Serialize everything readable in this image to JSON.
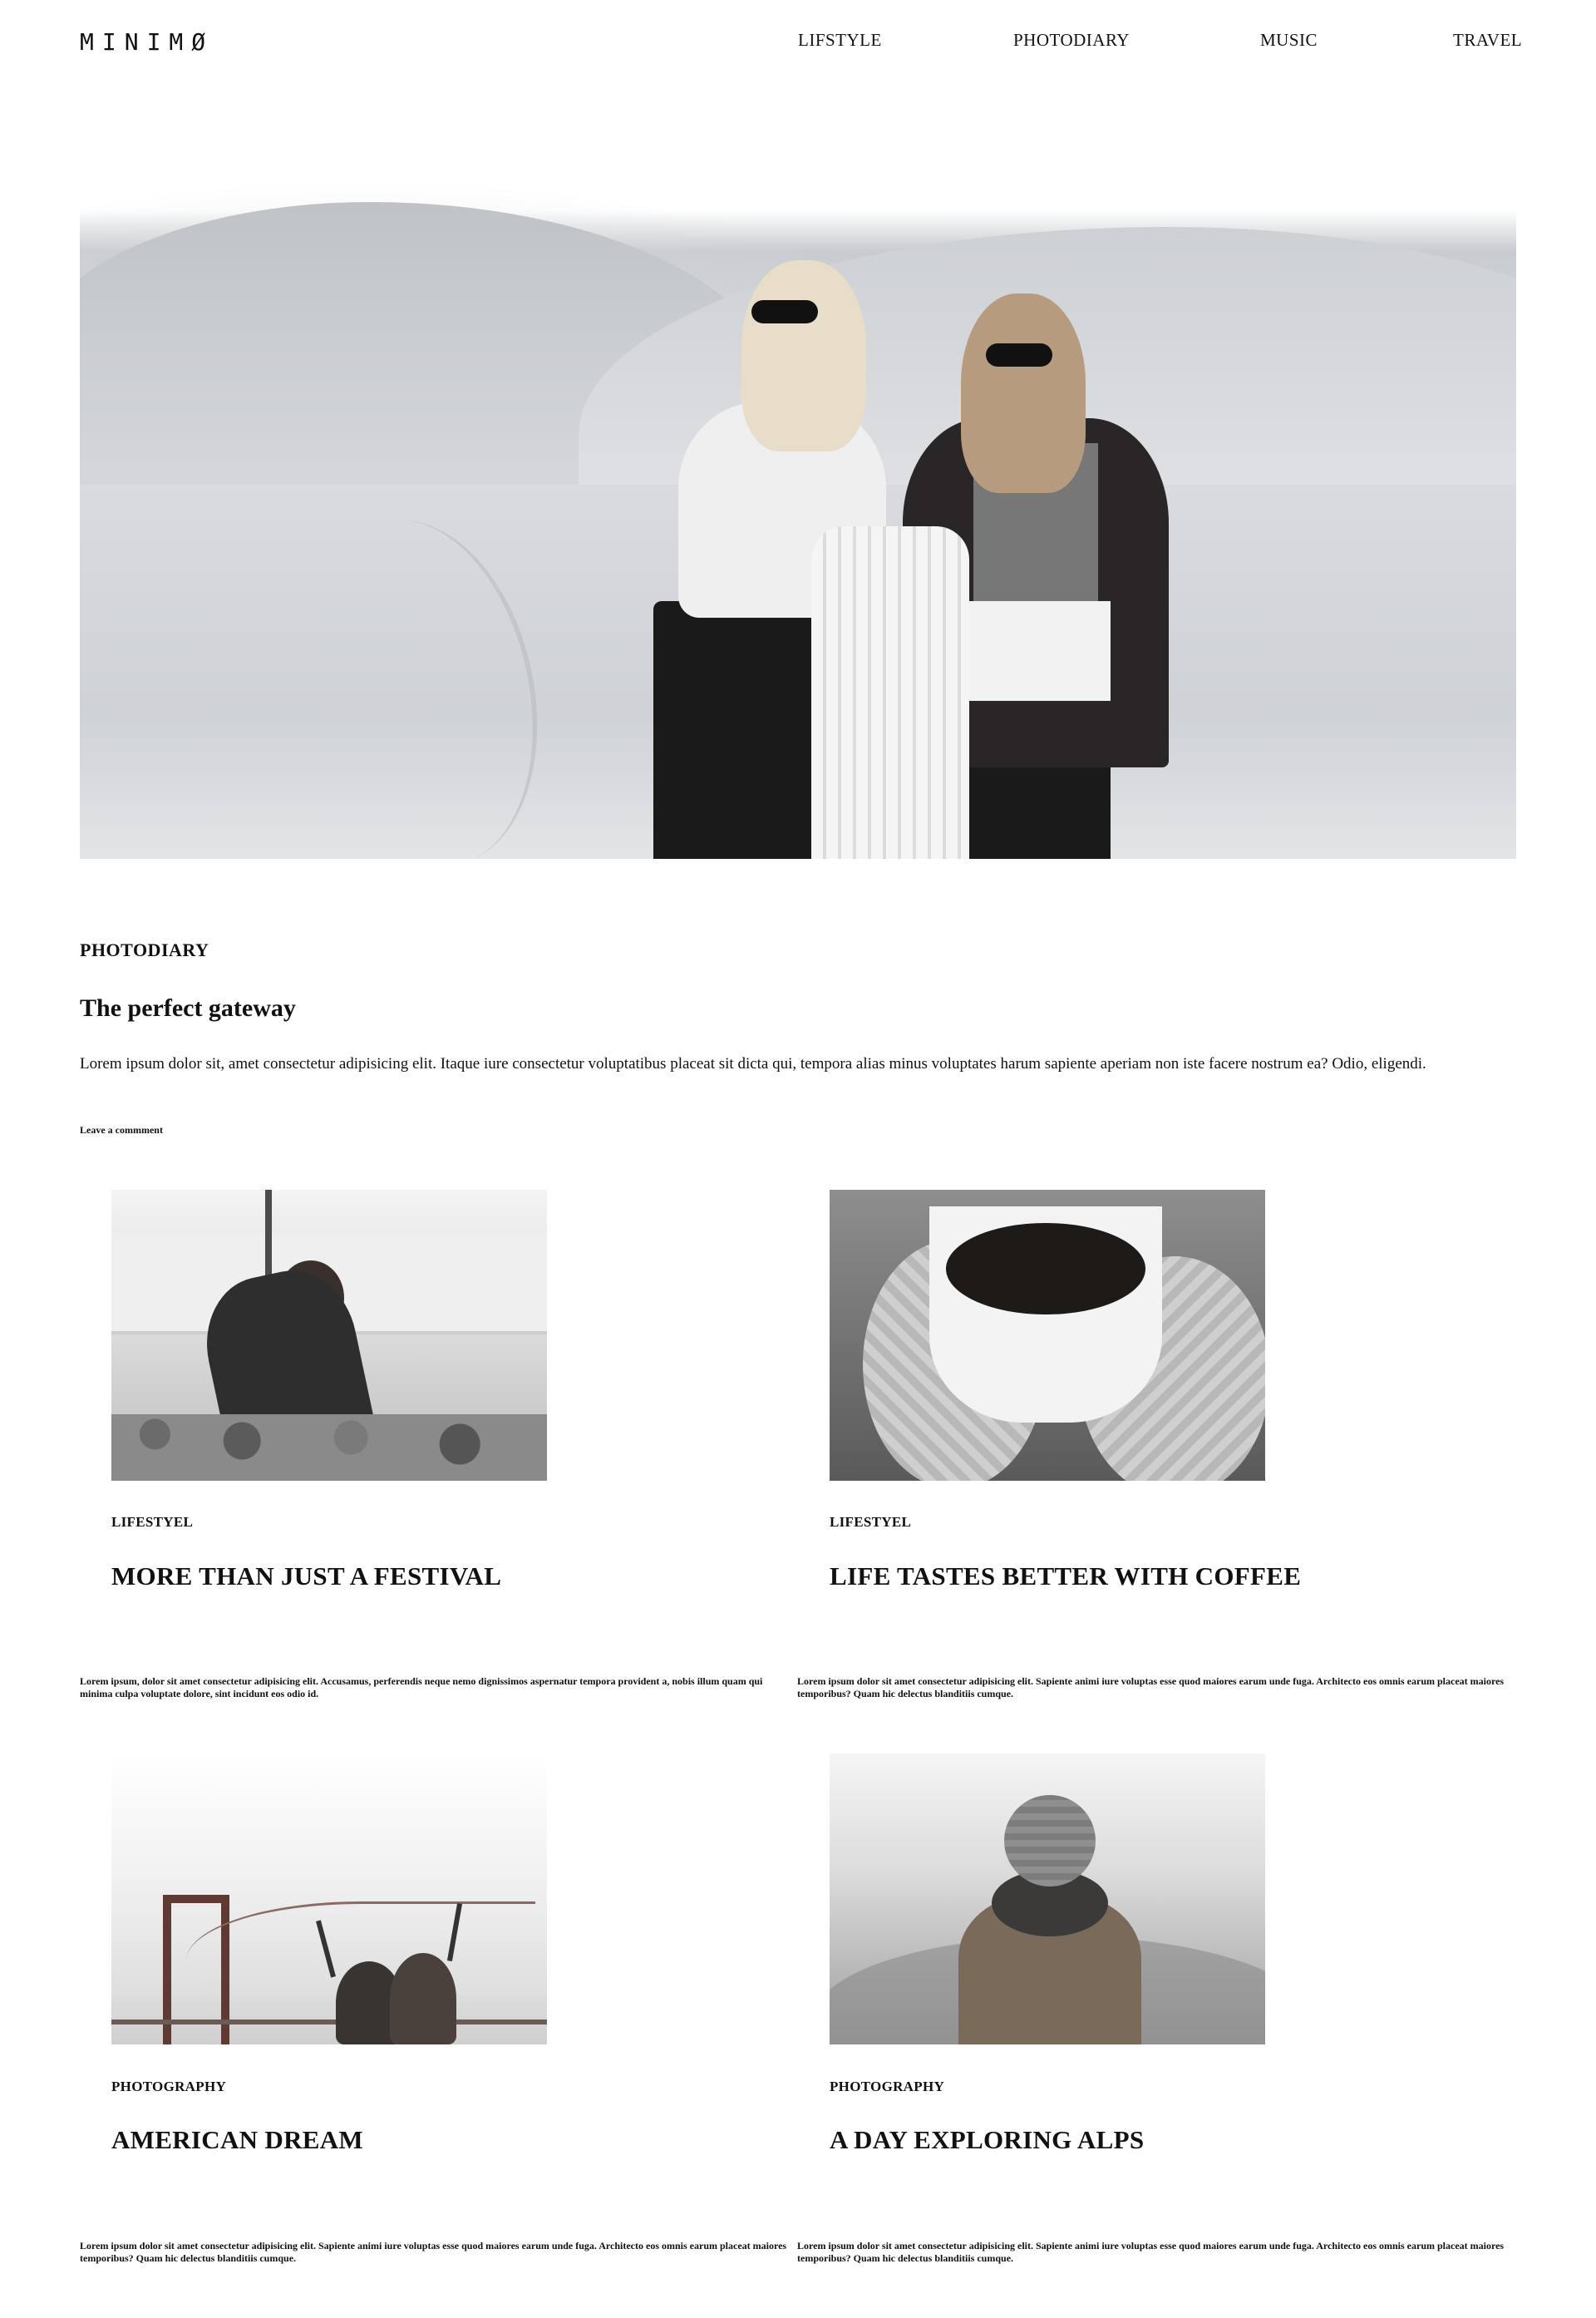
{
  "header": {
    "logo": "MINIMØ",
    "nav": [
      "LIFSTYLE",
      "PHOTODIARY",
      "MUSIC",
      "TRAVEL"
    ]
  },
  "featured": {
    "category": "PHOTODIARY",
    "title": "The perfect gateway",
    "text": "Lorem ipsum dolor sit, amet consectetur adipisicing elit. Itaque iure consectetur voluptatibus placeat sit dicta qui, tempora alias minus voluptates harum sapiente aperiam non iste facere nostrum ea? Odio, eligendi.",
    "comment_link": "Leave a commment"
  },
  "posts": [
    {
      "category": "LIFESTYEL",
      "title": "MORE THAN JUST A FESTIVAL",
      "text": "Lorem ipsum, dolor sit amet consectetur adipisicing elit. Accusamus, perferendis neque nemo dignissimos aspernatur tempora provident a, nobis illum quam qui minima culpa voluptate dolore, sint incidunt eos odio id."
    },
    {
      "category": "LIFESTYEL",
      "title": "LIFE TASTES BETTER WITH COFFEE",
      "text": "Lorem ipsum dolor sit amet consectetur adipisicing elit. Sapiente animi iure voluptas esse quod maiores earum unde fuga. Architecto eos omnis earum placeat maiores temporibus? Quam hic delectus blanditiis cumque."
    },
    {
      "category": "PHOTOGRAPHY",
      "title": "AMERICAN DREAM",
      "text": "Lorem ipsum dolor sit amet consectetur adipisicing elit. Sapiente animi iure voluptas esse quod maiores earum unde fuga. Architecto eos omnis earum placeat maiores temporibus? Quam hic delectus blanditiis cumque."
    },
    {
      "category": "PHOTOGRAPHY",
      "title": "A DAY EXPLORING ALPS",
      "text": "Lorem ipsum dolor sit amet consectetur adipisicing elit. Sapiente animi iure voluptas esse quod maiores earum unde fuga. Architecto eos omnis earum placeat maiores temporibus? Quam hic delectus blanditiis cumque."
    }
  ]
}
